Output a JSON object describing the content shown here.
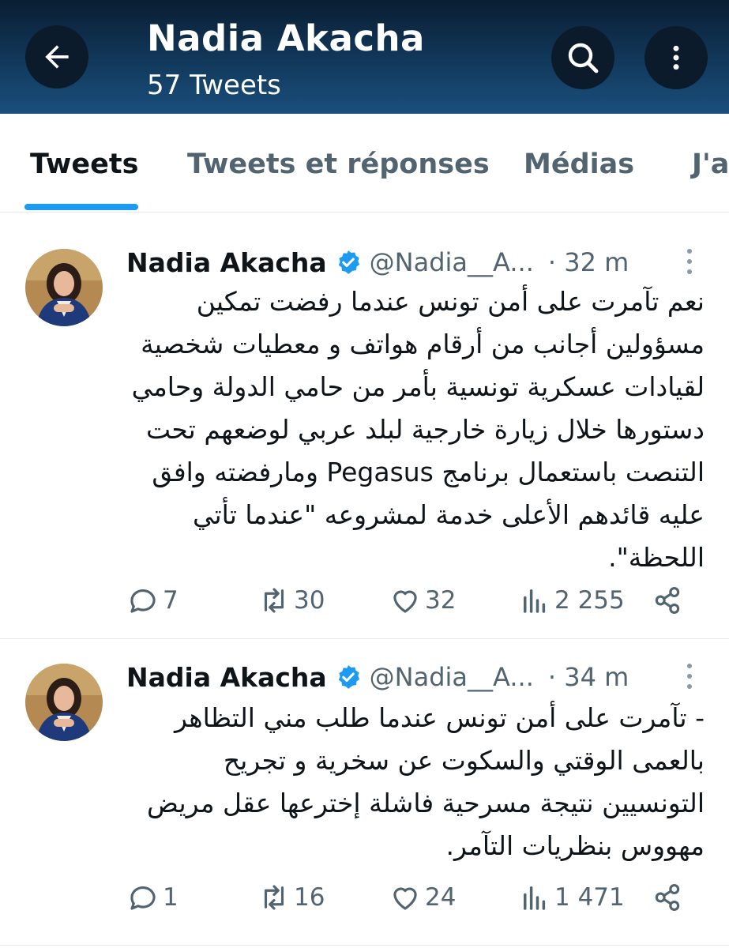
{
  "header": {
    "title": "Nadia Akacha",
    "subtitle": "57 Tweets",
    "back_icon": "arrow-left-icon",
    "search_icon": "search-icon",
    "more_icon": "more-vertical-icon",
    "bg_color": "#12395c"
  },
  "tabs": [
    {
      "label": "Tweets",
      "active": true
    },
    {
      "label": "Tweets et réponses",
      "active": false
    },
    {
      "label": "Médias",
      "active": false
    },
    {
      "label": "J'a",
      "active": false
    }
  ],
  "tweets": [
    {
      "name": "Nadia Akacha",
      "handle": "@Nadia__A...",
      "time": "· 32 m",
      "text": "نعم تآمرت على أمن تونس عندما رفضت تمكين مسؤولين أجانب من أرقام هواتف و معطيات شخصية لقيادات عسكرية تونسية بأمر من حامي الدولة وحامي دستورها خلال زيارة خارجية لبلد عربي لوضعهم تحت التنصت باستعمال برنامج Pegasus ومارفضته وافق عليه قائدهم الأعلى خدمة لمشروعه \"عندما تأتي اللحظة\".",
      "replies": "7",
      "retweets": "30",
      "likes": "32",
      "views": "2 255"
    },
    {
      "name": "Nadia Akacha",
      "handle": "@Nadia__A...",
      "time": "· 34 m",
      "text": "- تآمرت على أمن تونس عندما طلب مني التظاهر بالعمى الوقتي والسكوت عن سخرية و تجريح التونسيين نتيجة مسرحية فاشلة إخترعها عقل مريض مهووس بنظريات التآمر.",
      "replies": "1",
      "retweets": "16",
      "likes": "24",
      "views": "1 471"
    }
  ],
  "colors": {
    "accent": "#1d9bf0",
    "verified": "#1d9bf0",
    "muted_text": "#536471"
  }
}
